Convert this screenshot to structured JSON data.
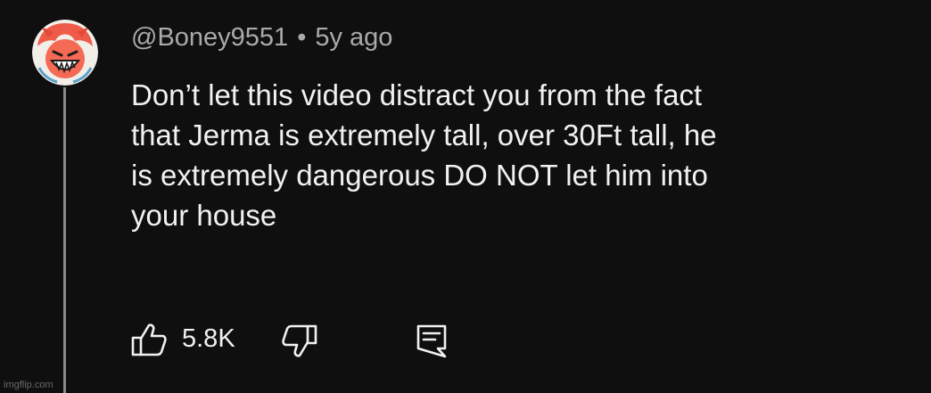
{
  "comment": {
    "author": "@Boney9551",
    "separator": "•",
    "timestamp": "5y ago",
    "text_lines": [
      "Don’t let this video distract you from the fact",
      "that Jerma is extremely tall, over 30Ft tall, he",
      "is extremely dangerous DO NOT let him into",
      "your house"
    ],
    "like_count": "5.8K"
  },
  "icons": {
    "avatar": "avatar-cartoon-grin",
    "like": "thumbs-up-icon",
    "dislike": "thumbs-down-icon",
    "reply": "reply-comment-icon"
  },
  "colors": {
    "background": "#0f0f0f",
    "text": "#f1f1f1",
    "muted_text": "#aaaaaa",
    "thread_line": "#8a8a8a",
    "avatar_accent": "#f05a47"
  },
  "watermark": "imgflip.com"
}
